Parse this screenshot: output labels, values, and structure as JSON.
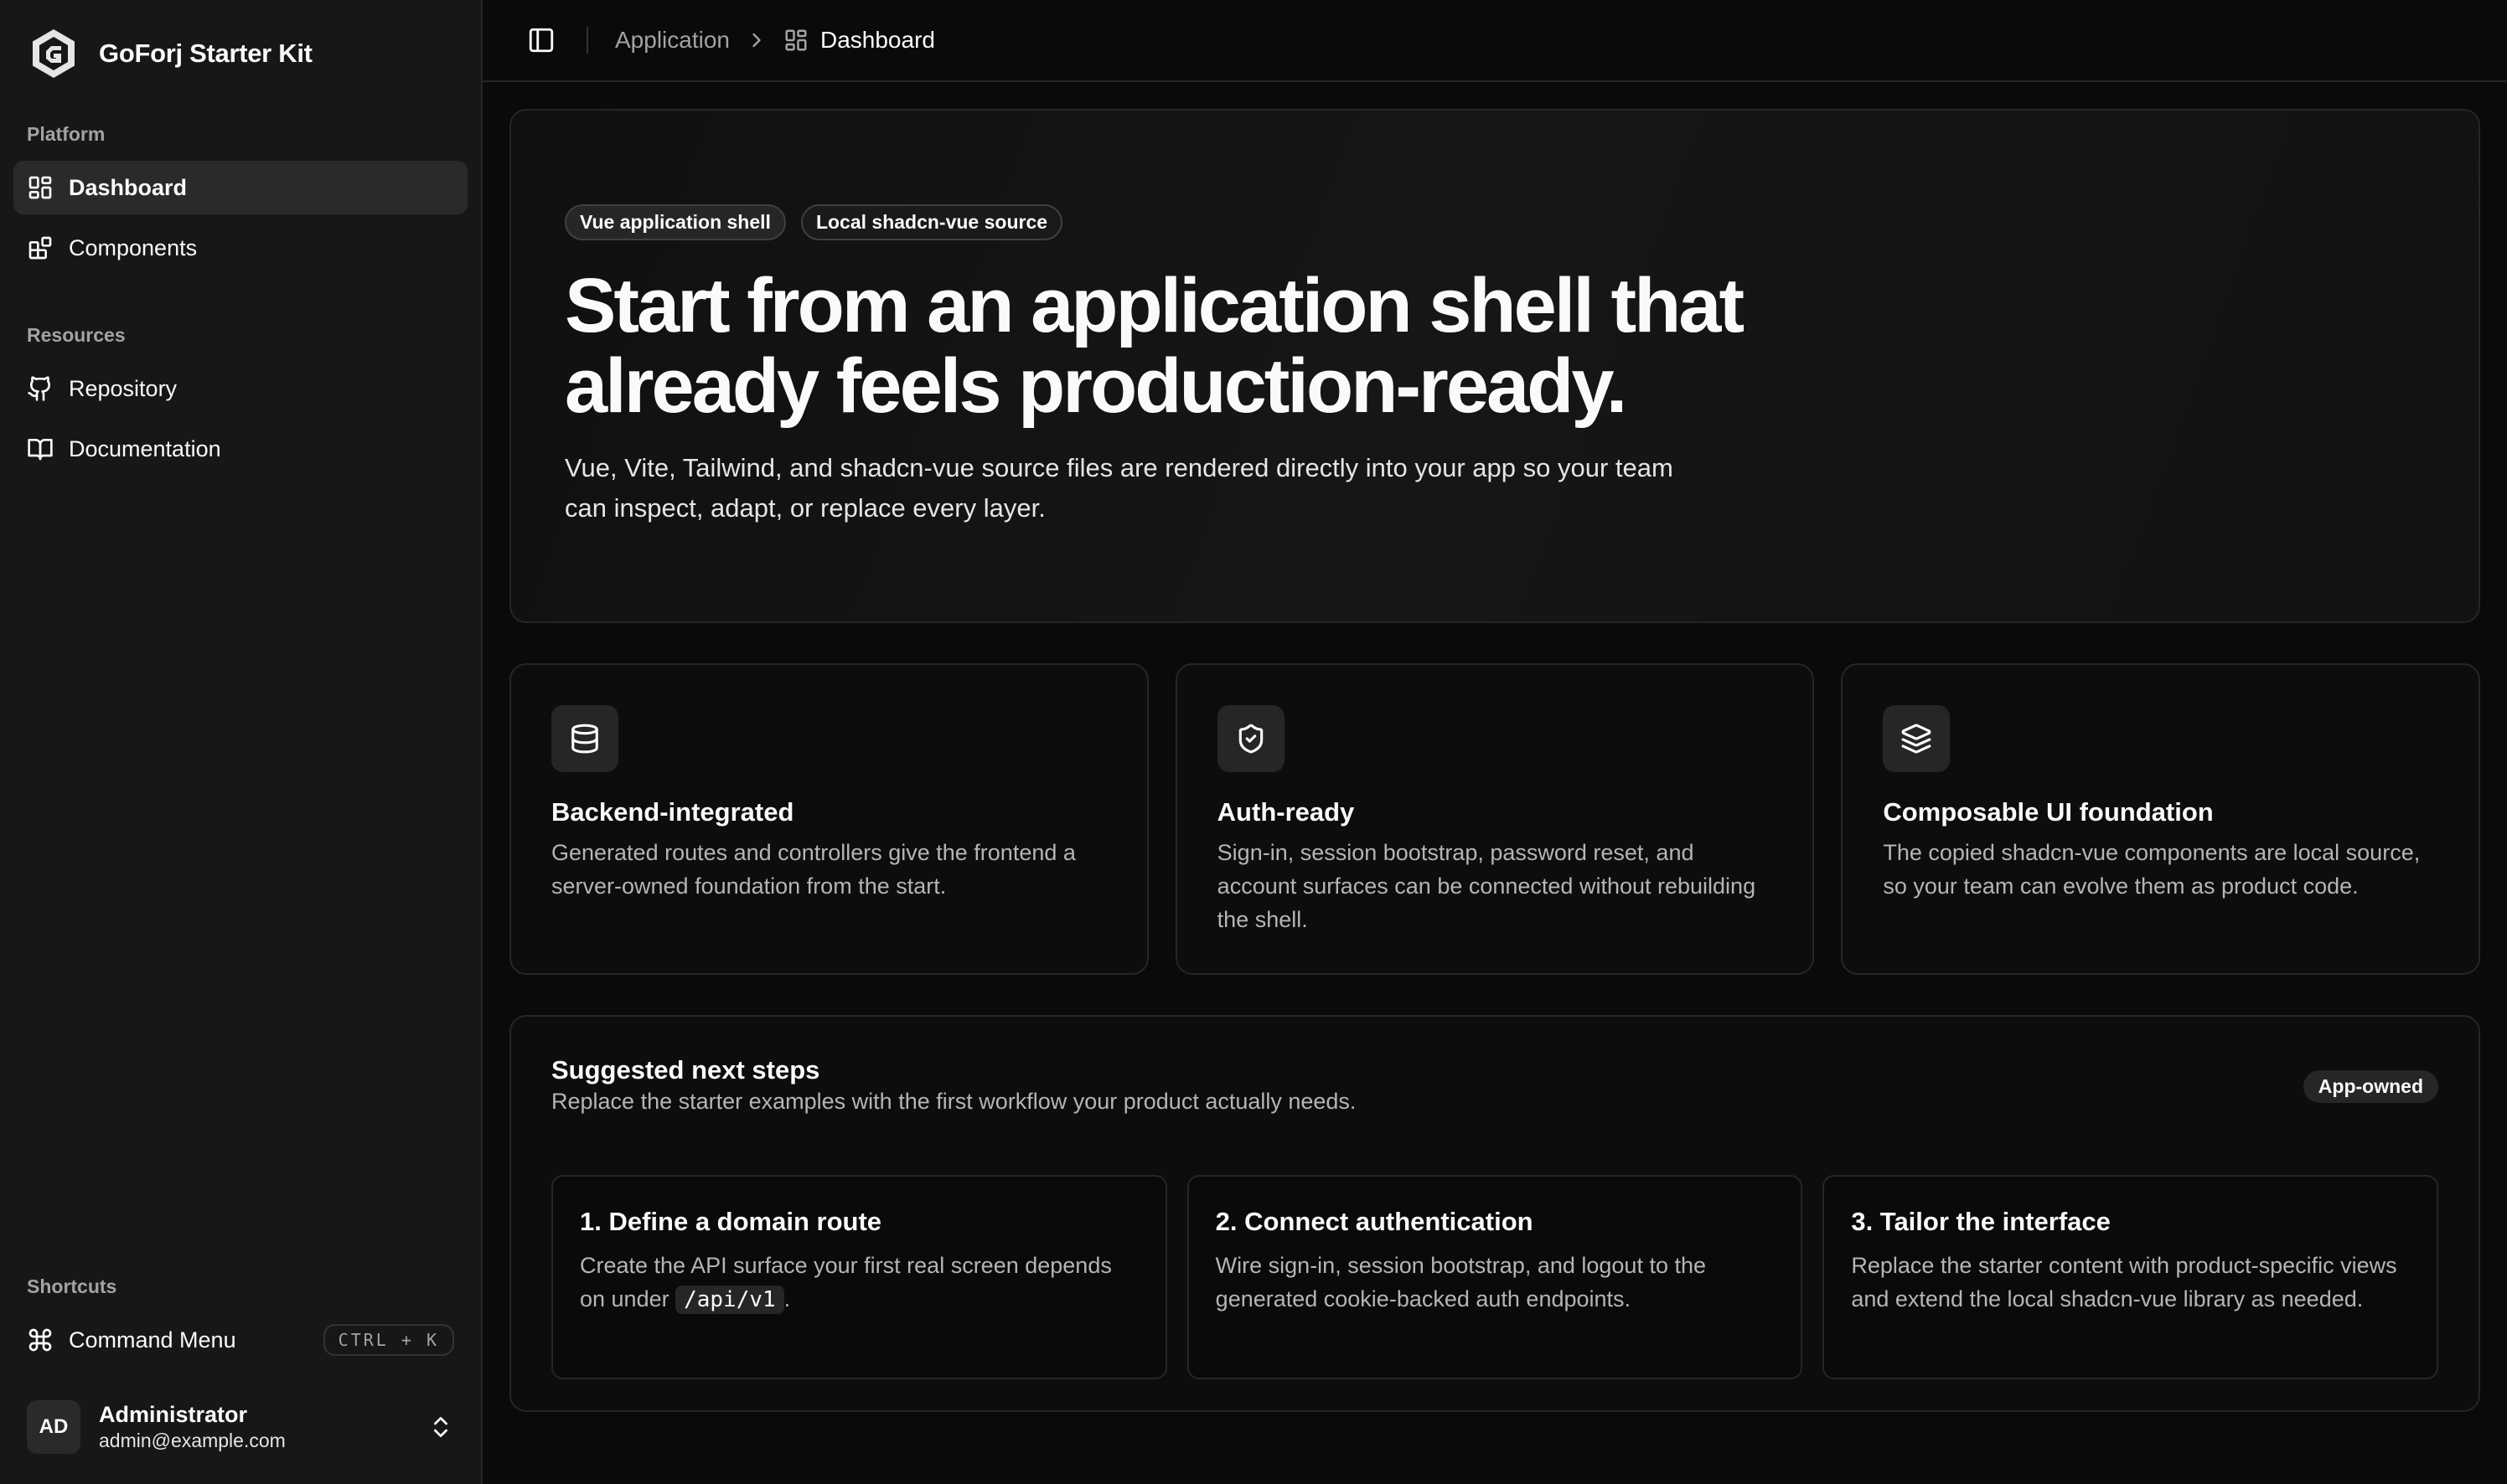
{
  "app": {
    "name": "GoForj Starter Kit"
  },
  "sidebar": {
    "platform_label": "Platform",
    "platform_items": [
      {
        "label": "Dashboard",
        "icon": "layout-grid-icon",
        "active": true
      },
      {
        "label": "Components",
        "icon": "blocks-icon",
        "active": false
      }
    ],
    "resources_label": "Resources",
    "resources_items": [
      {
        "label": "Repository",
        "icon": "github-icon"
      },
      {
        "label": "Documentation",
        "icon": "book-open-icon"
      }
    ],
    "shortcuts_label": "Shortcuts",
    "command_menu": {
      "label": "Command Menu",
      "shortcut": "CTRL + K",
      "icon": "command-icon"
    },
    "user": {
      "initials": "AD",
      "name": "Administrator",
      "email": "admin@example.com"
    }
  },
  "topbar": {
    "breadcrumb": [
      {
        "label": "Application"
      },
      {
        "label": "Dashboard",
        "icon": "layout-grid-icon"
      }
    ]
  },
  "hero": {
    "badges": [
      "Vue application shell",
      "Local shadcn-vue source"
    ],
    "title": "Start from an application shell that already feels production-ready.",
    "description": "Vue, Vite, Tailwind, and shadcn-vue source files are rendered directly into your app so your team can inspect, adapt, or replace every layer."
  },
  "features": [
    {
      "icon": "database-icon",
      "title": "Backend-integrated",
      "description": "Generated routes and controllers give the frontend a server-owned foundation from the start."
    },
    {
      "icon": "shield-check-icon",
      "title": "Auth-ready",
      "description": "Sign-in, session bootstrap, password reset, and account surfaces can be connected without rebuilding the shell."
    },
    {
      "icon": "layers-icon",
      "title": "Composable UI foundation",
      "description": "The copied shadcn-vue components are local source, so your team can evolve them as product code."
    }
  ],
  "next_steps": {
    "title": "Suggested next steps",
    "subtitle": "Replace the starter examples with the first workflow your product actually needs.",
    "badge": "App-owned",
    "steps": [
      {
        "title": "1. Define a domain route",
        "desc_before": "Create the API surface your first real screen depends on under ",
        "code": "/api/v1",
        "desc_after": "."
      },
      {
        "title": "2. Connect authentication",
        "description": "Wire sign-in, session bootstrap, and logout to the generated cookie-backed auth endpoints."
      },
      {
        "title": "3. Tailor the interface",
        "description": "Replace the starter content with product-specific views and extend the local shadcn-vue library as needed."
      }
    ]
  },
  "colors": {
    "background": "#0a0a0a",
    "sidebar": "#171717",
    "border": "#262626",
    "muted_text": "#a3a3a3",
    "active_item": "#2a2a2a"
  }
}
